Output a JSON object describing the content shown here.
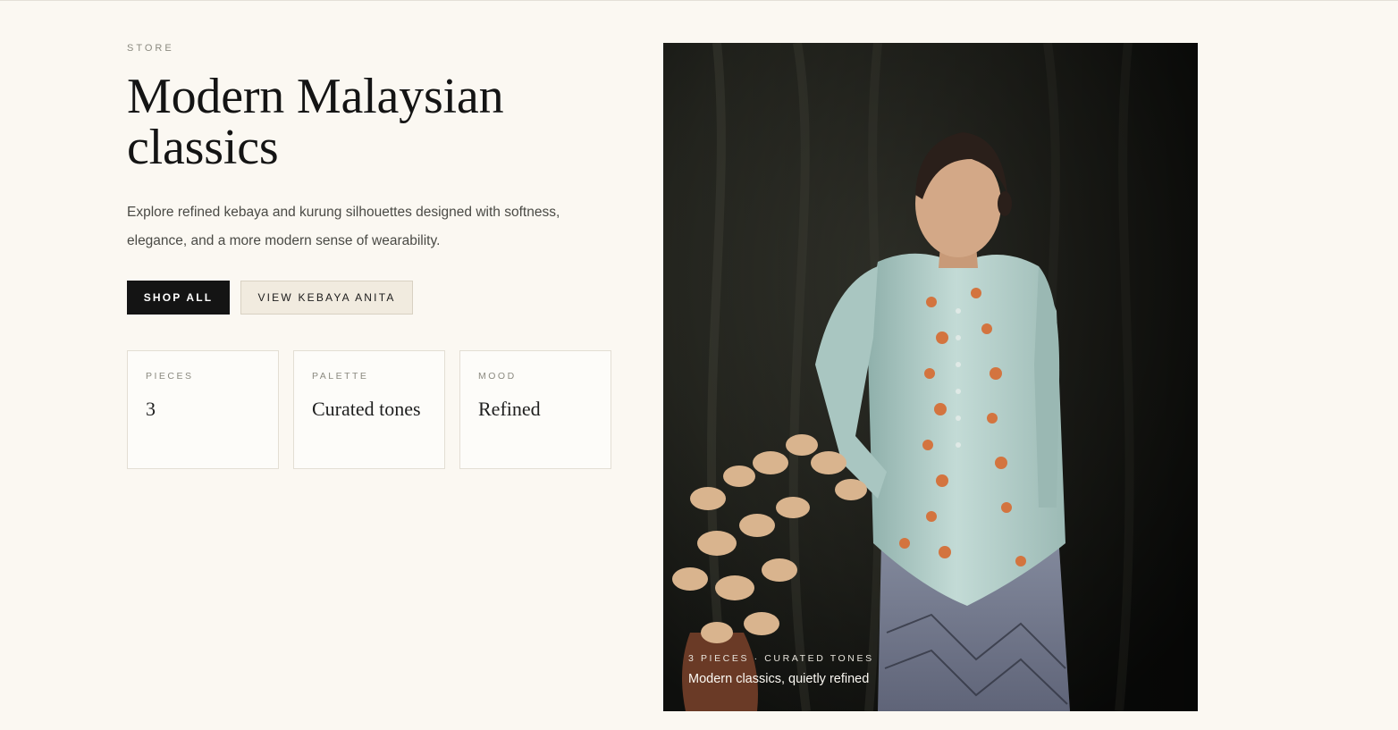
{
  "hero": {
    "eyebrow": "STORE",
    "title": "Modern Malaysian classics",
    "description": "Explore refined kebaya and kurung silhouettes designed with softness, elegance, and a more modern sense of wearability.",
    "buttons": {
      "primary": "SHOP ALL",
      "secondary": "VIEW KEBAYA ANITA"
    },
    "stats": [
      {
        "label": "PIECES",
        "value": "3"
      },
      {
        "label": "PALETTE",
        "value": "Curated tones"
      },
      {
        "label": "MOOD",
        "value": "Refined"
      }
    ]
  },
  "image": {
    "caption_eyebrow": "3 PIECES · CURATED TONES",
    "caption_text": "Modern classics, quietly refined"
  },
  "colors": {
    "background": "#fbf8f2",
    "primary_button": "#141414",
    "secondary_button": "#f1ebdf",
    "kebaya": "#b9d3cf",
    "backdrop": "#1a1c17"
  }
}
